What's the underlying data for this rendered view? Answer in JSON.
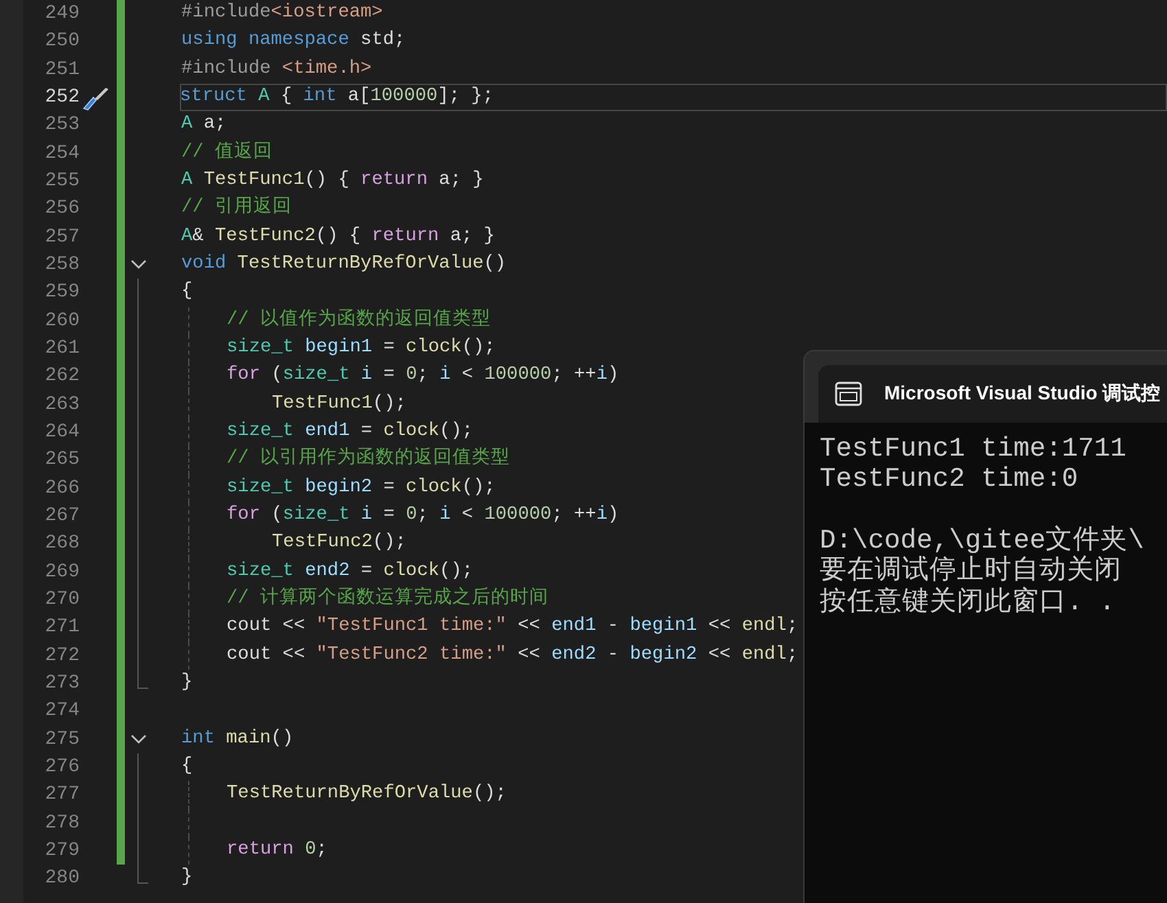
{
  "editor": {
    "lines": [
      {
        "number": "249",
        "tokens": [
          {
            "text": "#include",
            "kind": "pre"
          },
          {
            "text": "<iostream>",
            "kind": "str"
          }
        ]
      },
      {
        "number": "250",
        "tokens": [
          {
            "text": "using namespace ",
            "kind": "kw"
          },
          {
            "text": "std;",
            "kind": "plain"
          }
        ]
      },
      {
        "number": "251",
        "tokens": [
          {
            "text": "#include ",
            "kind": "pre"
          },
          {
            "text": "<time.h>",
            "kind": "str"
          }
        ]
      },
      {
        "number": "252",
        "current": true,
        "tokens": [
          {
            "text": "struct ",
            "kind": "kw"
          },
          {
            "text": "A ",
            "kind": "type"
          },
          {
            "text": "{ ",
            "kind": "plain"
          },
          {
            "text": "int ",
            "kind": "kw"
          },
          {
            "text": "a[",
            "kind": "plain"
          },
          {
            "text": "100000",
            "kind": "num"
          },
          {
            "text": "]; };",
            "kind": "plain"
          }
        ]
      },
      {
        "number": "253",
        "tokens": [
          {
            "text": "A ",
            "kind": "type"
          },
          {
            "text": "a;",
            "kind": "plain"
          }
        ]
      },
      {
        "number": "254",
        "tokens": [
          {
            "text": "// 值返回",
            "kind": "comment"
          }
        ]
      },
      {
        "number": "255",
        "tokens": [
          {
            "text": "A ",
            "kind": "type"
          },
          {
            "text": "TestFunc1",
            "kind": "fn"
          },
          {
            "text": "() { ",
            "kind": "plain"
          },
          {
            "text": "return ",
            "kind": "ctl"
          },
          {
            "text": "a; }",
            "kind": "plain"
          }
        ]
      },
      {
        "number": "256",
        "tokens": [
          {
            "text": "// 引用返回",
            "kind": "comment"
          }
        ]
      },
      {
        "number": "257",
        "tokens": [
          {
            "text": "A",
            "kind": "type"
          },
          {
            "text": "& ",
            "kind": "plain"
          },
          {
            "text": "TestFunc2",
            "kind": "fn"
          },
          {
            "text": "() { ",
            "kind": "plain"
          },
          {
            "text": "return ",
            "kind": "ctl"
          },
          {
            "text": "a; }",
            "kind": "plain"
          }
        ]
      },
      {
        "number": "258",
        "expanded": true,
        "tokens": [
          {
            "text": "void ",
            "kind": "kw"
          },
          {
            "text": "TestReturnByRefOrValue",
            "kind": "fn"
          },
          {
            "text": "()",
            "kind": "plain"
          }
        ],
        "body": [
          {
            "number": "259",
            "tokens": [
              {
                "text": "{",
                "kind": "plain"
              }
            ],
            "children": [
              {
                "number": "260",
                "tokens": [
                  {
                    "text": "// 以值作为函数的返回值类型",
                    "kind": "comment"
                  }
                ]
              },
              {
                "number": "261",
                "tokens": [
                  {
                    "text": "size_t ",
                    "kind": "type"
                  },
                  {
                    "text": "begin1",
                    "kind": "var"
                  },
                  {
                    "text": " = ",
                    "kind": "plain"
                  },
                  {
                    "text": "clock",
                    "kind": "fn"
                  },
                  {
                    "text": "();",
                    "kind": "plain"
                  }
                ]
              },
              {
                "number": "262",
                "tokens": [
                  {
                    "text": "for ",
                    "kind": "ctl"
                  },
                  {
                    "text": "(",
                    "kind": "plain"
                  },
                  {
                    "text": "size_t ",
                    "kind": "type"
                  },
                  {
                    "text": "i",
                    "kind": "var"
                  },
                  {
                    "text": " = ",
                    "kind": "plain"
                  },
                  {
                    "text": "0",
                    "kind": "num"
                  },
                  {
                    "text": "; ",
                    "kind": "plain"
                  },
                  {
                    "text": "i",
                    "kind": "var"
                  },
                  {
                    "text": " < ",
                    "kind": "plain"
                  },
                  {
                    "text": "100000",
                    "kind": "num"
                  },
                  {
                    "text": "; ++",
                    "kind": "plain"
                  },
                  {
                    "text": "i",
                    "kind": "var"
                  },
                  {
                    "text": ")",
                    "kind": "plain"
                  }
                ],
                "children": [
                  {
                    "number": "263",
                    "tokens": [
                      {
                        "text": "TestFunc1",
                        "kind": "fn"
                      },
                      {
                        "text": "();",
                        "kind": "plain"
                      }
                    ]
                  }
                ]
              },
              {
                "number": "264",
                "tokens": [
                  {
                    "text": "size_t ",
                    "kind": "type"
                  },
                  {
                    "text": "end1",
                    "kind": "var"
                  },
                  {
                    "text": " = ",
                    "kind": "plain"
                  },
                  {
                    "text": "clock",
                    "kind": "fn"
                  },
                  {
                    "text": "();",
                    "kind": "plain"
                  }
                ]
              },
              {
                "number": "265",
                "tokens": [
                  {
                    "text": "// 以引用作为函数的返回值类型",
                    "kind": "comment"
                  }
                ]
              },
              {
                "number": "266",
                "tokens": [
                  {
                    "text": "size_t ",
                    "kind": "type"
                  },
                  {
                    "text": "begin2",
                    "kind": "var"
                  },
                  {
                    "text": " = ",
                    "kind": "plain"
                  },
                  {
                    "text": "clock",
                    "kind": "fn"
                  },
                  {
                    "text": "();",
                    "kind": "plain"
                  }
                ]
              },
              {
                "number": "267",
                "tokens": [
                  {
                    "text": "for ",
                    "kind": "ctl"
                  },
                  {
                    "text": "(",
                    "kind": "plain"
                  },
                  {
                    "text": "size_t ",
                    "kind": "type"
                  },
                  {
                    "text": "i",
                    "kind": "var"
                  },
                  {
                    "text": " = ",
                    "kind": "plain"
                  },
                  {
                    "text": "0",
                    "kind": "num"
                  },
                  {
                    "text": "; ",
                    "kind": "plain"
                  },
                  {
                    "text": "i",
                    "kind": "var"
                  },
                  {
                    "text": " < ",
                    "kind": "plain"
                  },
                  {
                    "text": "100000",
                    "kind": "num"
                  },
                  {
                    "text": "; ++",
                    "kind": "plain"
                  },
                  {
                    "text": "i",
                    "kind": "var"
                  },
                  {
                    "text": ")",
                    "kind": "plain"
                  }
                ],
                "children": [
                  {
                    "number": "268",
                    "tokens": [
                      {
                        "text": "TestFunc2",
                        "kind": "fn"
                      },
                      {
                        "text": "();",
                        "kind": "plain"
                      }
                    ]
                  }
                ]
              },
              {
                "number": "269",
                "tokens": [
                  {
                    "text": "size_t ",
                    "kind": "type"
                  },
                  {
                    "text": "end2",
                    "kind": "var"
                  },
                  {
                    "text": " = ",
                    "kind": "plain"
                  },
                  {
                    "text": "clock",
                    "kind": "fn"
                  },
                  {
                    "text": "();",
                    "kind": "plain"
                  }
                ]
              },
              {
                "number": "270",
                "tokens": [
                  {
                    "text": "// 计算两个函数运算完成之后的时间",
                    "kind": "comment"
                  }
                ]
              },
              {
                "number": "271",
                "tokens": [
                  {
                    "text": "cout << ",
                    "kind": "plain"
                  },
                  {
                    "text": "\"TestFunc1 time:\"",
                    "kind": "str"
                  },
                  {
                    "text": " << ",
                    "kind": "plain"
                  },
                  {
                    "text": "end1",
                    "kind": "var"
                  },
                  {
                    "text": " - ",
                    "kind": "plain"
                  },
                  {
                    "text": "begin1",
                    "kind": "var"
                  },
                  {
                    "text": " << ",
                    "kind": "plain"
                  },
                  {
                    "text": "endl",
                    "kind": "fn"
                  },
                  {
                    "text": ";",
                    "kind": "plain"
                  }
                ]
              },
              {
                "number": "272",
                "tokens": [
                  {
                    "text": "cout << ",
                    "kind": "plain"
                  },
                  {
                    "text": "\"TestFunc2 time:\"",
                    "kind": "str"
                  },
                  {
                    "text": " << ",
                    "kind": "plain"
                  },
                  {
                    "text": "end2",
                    "kind": "var"
                  },
                  {
                    "text": " - ",
                    "kind": "plain"
                  },
                  {
                    "text": "begin2",
                    "kind": "var"
                  },
                  {
                    "text": " << ",
                    "kind": "plain"
                  },
                  {
                    "text": "endl",
                    "kind": "fn"
                  },
                  {
                    "text": ";",
                    "kind": "plain"
                  }
                ]
              }
            ]
          },
          {
            "number": "273",
            "tokens": [
              {
                "text": "}",
                "kind": "plain"
              }
            ]
          }
        ]
      },
      {
        "number": "274"
      },
      {
        "number": "275",
        "expanded": true,
        "tokens": [
          {
            "text": "int ",
            "kind": "kw"
          },
          {
            "text": "main",
            "kind": "fn"
          },
          {
            "text": "()",
            "kind": "plain"
          }
        ],
        "body": [
          {
            "number": "276",
            "tokens": [
              {
                "text": "{",
                "kind": "plain"
              }
            ],
            "children": [
              {
                "number": "277",
                "tokens": [
                  {
                    "text": "TestReturnByRefOrValue",
                    "kind": "fn"
                  },
                  {
                    "text": "();",
                    "kind": "plain"
                  }
                ]
              },
              {
                "number": "278"
              },
              {
                "number": "279",
                "tokens": [
                  {
                    "text": "return ",
                    "kind": "ctl"
                  },
                  {
                    "text": "0",
                    "kind": "num"
                  },
                  {
                    "text": ";",
                    "kind": "plain"
                  }
                ]
              }
            ]
          },
          {
            "number": "280",
            "tokens": [
              {
                "text": "}",
                "kind": "plain"
              }
            ]
          }
        ]
      }
    ]
  },
  "console": {
    "title": "Microsoft Visual Studio 调试控",
    "blocks": [
      [
        "TestFunc1 time:1711",
        "TestFunc2 time:0"
      ],
      [
        "D:\\code,\\gitee文件夹\\",
        "要在调试停止时自动关闭",
        "按任意键关闭此窗口. ."
      ]
    ]
  }
}
